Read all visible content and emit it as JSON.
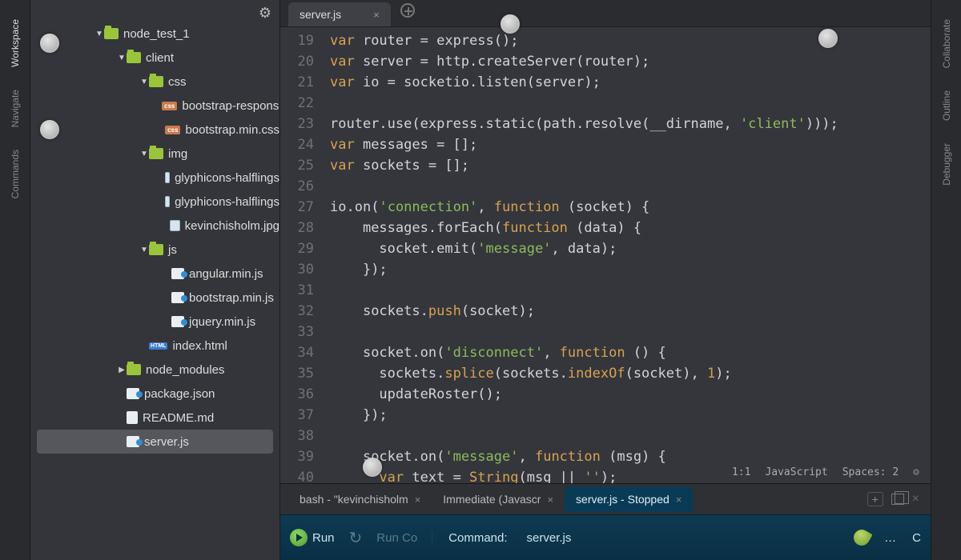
{
  "leftRail": {
    "tabs": [
      "Workspace",
      "Navigate",
      "Commands"
    ],
    "activeIndex": 0
  },
  "rightRail": {
    "tabs": [
      "Collaborate",
      "Outline",
      "Debugger"
    ]
  },
  "sidebar": {
    "tree": [
      {
        "depth": 0,
        "type": "folder",
        "caret": "down",
        "label": "node_test_1"
      },
      {
        "depth": 1,
        "type": "folder",
        "caret": "down",
        "label": "client"
      },
      {
        "depth": 2,
        "type": "folder",
        "caret": "down",
        "label": "css"
      },
      {
        "depth": 3,
        "type": "css",
        "label": "bootstrap-responsiv"
      },
      {
        "depth": 3,
        "type": "css",
        "label": "bootstrap.min.css"
      },
      {
        "depth": 2,
        "type": "folder",
        "caret": "down",
        "label": "img"
      },
      {
        "depth": 3,
        "type": "img",
        "label": "glyphicons-halflings"
      },
      {
        "depth": 3,
        "type": "img",
        "label": "glyphicons-halflings"
      },
      {
        "depth": 3,
        "type": "img",
        "label": "kevinchisholm.jpg"
      },
      {
        "depth": 2,
        "type": "folder",
        "caret": "down",
        "label": "js"
      },
      {
        "depth": 3,
        "type": "js",
        "label": "angular.min.js"
      },
      {
        "depth": 3,
        "type": "js",
        "label": "bootstrap.min.js"
      },
      {
        "depth": 3,
        "type": "js",
        "label": "jquery.min.js"
      },
      {
        "depth": 2,
        "type": "html",
        "label": "index.html"
      },
      {
        "depth": 1,
        "type": "folder",
        "caret": "right",
        "label": "node_modules"
      },
      {
        "depth": 1,
        "type": "js",
        "label": "package.json"
      },
      {
        "depth": 1,
        "type": "doc",
        "label": "README.md"
      },
      {
        "depth": 1,
        "type": "js",
        "label": "server.js",
        "selected": true
      }
    ]
  },
  "editor": {
    "tab": {
      "title": "server.js"
    },
    "code": {
      "startLine": 19,
      "lines": [
        [
          [
            "kw",
            "var"
          ],
          [
            "id",
            " router "
          ],
          [
            "op",
            "= "
          ],
          [
            "id",
            "express"
          ],
          [
            "op",
            "();"
          ]
        ],
        [
          [
            "kw",
            "var"
          ],
          [
            "id",
            " server "
          ],
          [
            "op",
            "= "
          ],
          [
            "id",
            "http"
          ],
          [
            "op",
            "."
          ],
          [
            "id",
            "createServer"
          ],
          [
            "op",
            "("
          ],
          [
            "id",
            "router"
          ],
          [
            "op",
            ");"
          ]
        ],
        [
          [
            "kw",
            "var"
          ],
          [
            "id",
            " io "
          ],
          [
            "op",
            "= "
          ],
          [
            "id",
            "socketio"
          ],
          [
            "op",
            "."
          ],
          [
            "id",
            "listen"
          ],
          [
            "op",
            "("
          ],
          [
            "id",
            "server"
          ],
          [
            "op",
            ");"
          ]
        ],
        [],
        [
          [
            "id",
            "router"
          ],
          [
            "op",
            "."
          ],
          [
            "id",
            "use"
          ],
          [
            "op",
            "("
          ],
          [
            "id",
            "express"
          ],
          [
            "op",
            "."
          ],
          [
            "id",
            "static"
          ],
          [
            "op",
            "("
          ],
          [
            "id",
            "path"
          ],
          [
            "op",
            "."
          ],
          [
            "id",
            "resolve"
          ],
          [
            "op",
            "("
          ],
          [
            "id",
            "__dirname"
          ],
          [
            "op",
            ", "
          ],
          [
            "str",
            "'client'"
          ],
          [
            "op",
            ")));"
          ]
        ],
        [
          [
            "kw",
            "var"
          ],
          [
            "id",
            " messages "
          ],
          [
            "op",
            "= [];"
          ]
        ],
        [
          [
            "kw",
            "var"
          ],
          [
            "id",
            " sockets "
          ],
          [
            "op",
            "= [];"
          ]
        ],
        [],
        [
          [
            "id",
            "io"
          ],
          [
            "op",
            "."
          ],
          [
            "id",
            "on"
          ],
          [
            "op",
            "("
          ],
          [
            "str",
            "'connection'"
          ],
          [
            "op",
            ", "
          ],
          [
            "kw",
            "function"
          ],
          [
            "op",
            " ("
          ],
          [
            "id",
            "socket"
          ],
          [
            "op",
            ") {"
          ]
        ],
        [
          [
            "pad",
            "    "
          ],
          [
            "id",
            "messages"
          ],
          [
            "op",
            "."
          ],
          [
            "id",
            "forEach"
          ],
          [
            "op",
            "("
          ],
          [
            "kw",
            "function"
          ],
          [
            "op",
            " ("
          ],
          [
            "id",
            "data"
          ],
          [
            "op",
            ") {"
          ]
        ],
        [
          [
            "pad",
            "      "
          ],
          [
            "id",
            "socket"
          ],
          [
            "op",
            "."
          ],
          [
            "id",
            "emit"
          ],
          [
            "op",
            "("
          ],
          [
            "str",
            "'message'"
          ],
          [
            "op",
            ", "
          ],
          [
            "id",
            "data"
          ],
          [
            "op",
            ");"
          ]
        ],
        [
          [
            "pad",
            "    "
          ],
          [
            "op",
            "});"
          ]
        ],
        [],
        [
          [
            "pad",
            "    "
          ],
          [
            "id",
            "sockets"
          ],
          [
            "op",
            "."
          ],
          [
            "prop",
            "push"
          ],
          [
            "op",
            "("
          ],
          [
            "id",
            "socket"
          ],
          [
            "op",
            ");"
          ]
        ],
        [],
        [
          [
            "pad",
            "    "
          ],
          [
            "id",
            "socket"
          ],
          [
            "op",
            "."
          ],
          [
            "id",
            "on"
          ],
          [
            "op",
            "("
          ],
          [
            "str",
            "'disconnect'"
          ],
          [
            "op",
            ", "
          ],
          [
            "kw",
            "function"
          ],
          [
            "op",
            " () {"
          ]
        ],
        [
          [
            "pad",
            "      "
          ],
          [
            "id",
            "sockets"
          ],
          [
            "op",
            "."
          ],
          [
            "prop",
            "splice"
          ],
          [
            "op",
            "("
          ],
          [
            "id",
            "sockets"
          ],
          [
            "op",
            "."
          ],
          [
            "prop",
            "indexOf"
          ],
          [
            "op",
            "("
          ],
          [
            "id",
            "socket"
          ],
          [
            "op",
            "), "
          ],
          [
            "num",
            "1"
          ],
          [
            "op",
            ");"
          ]
        ],
        [
          [
            "pad",
            "      "
          ],
          [
            "id",
            "updateRoster"
          ],
          [
            "op",
            "();"
          ]
        ],
        [
          [
            "pad",
            "    "
          ],
          [
            "op",
            "});"
          ]
        ],
        [],
        [
          [
            "pad",
            "    "
          ],
          [
            "id",
            "socket"
          ],
          [
            "op",
            "."
          ],
          [
            "id",
            "on"
          ],
          [
            "op",
            "("
          ],
          [
            "str",
            "'message'"
          ],
          [
            "op",
            ", "
          ],
          [
            "kw",
            "function"
          ],
          [
            "op",
            " ("
          ],
          [
            "id",
            "msg"
          ],
          [
            "op",
            ") {"
          ]
        ],
        [
          [
            "pad",
            "      "
          ],
          [
            "kw",
            "var"
          ],
          [
            "id",
            " text "
          ],
          [
            "op",
            "= "
          ],
          [
            "type",
            "String"
          ],
          [
            "op",
            "("
          ],
          [
            "id",
            "msg"
          ],
          [
            "op",
            " || "
          ],
          [
            "str",
            "''"
          ],
          [
            "op",
            ");"
          ]
        ]
      ]
    },
    "status": {
      "cursor": "1:1",
      "lang": "JavaScript",
      "spaces": "Spaces: 2"
    }
  },
  "bottom": {
    "tabs": [
      {
        "label": "bash - \"kevinchisholm"
      },
      {
        "label": "Immediate (Javascr"
      },
      {
        "label": "server.js - Stopped",
        "active": true
      }
    ],
    "runbar": {
      "run": "Run",
      "runco": "Run Co",
      "commandLabel": "Command:",
      "commandValue": "server.js",
      "rightText": "C"
    }
  }
}
